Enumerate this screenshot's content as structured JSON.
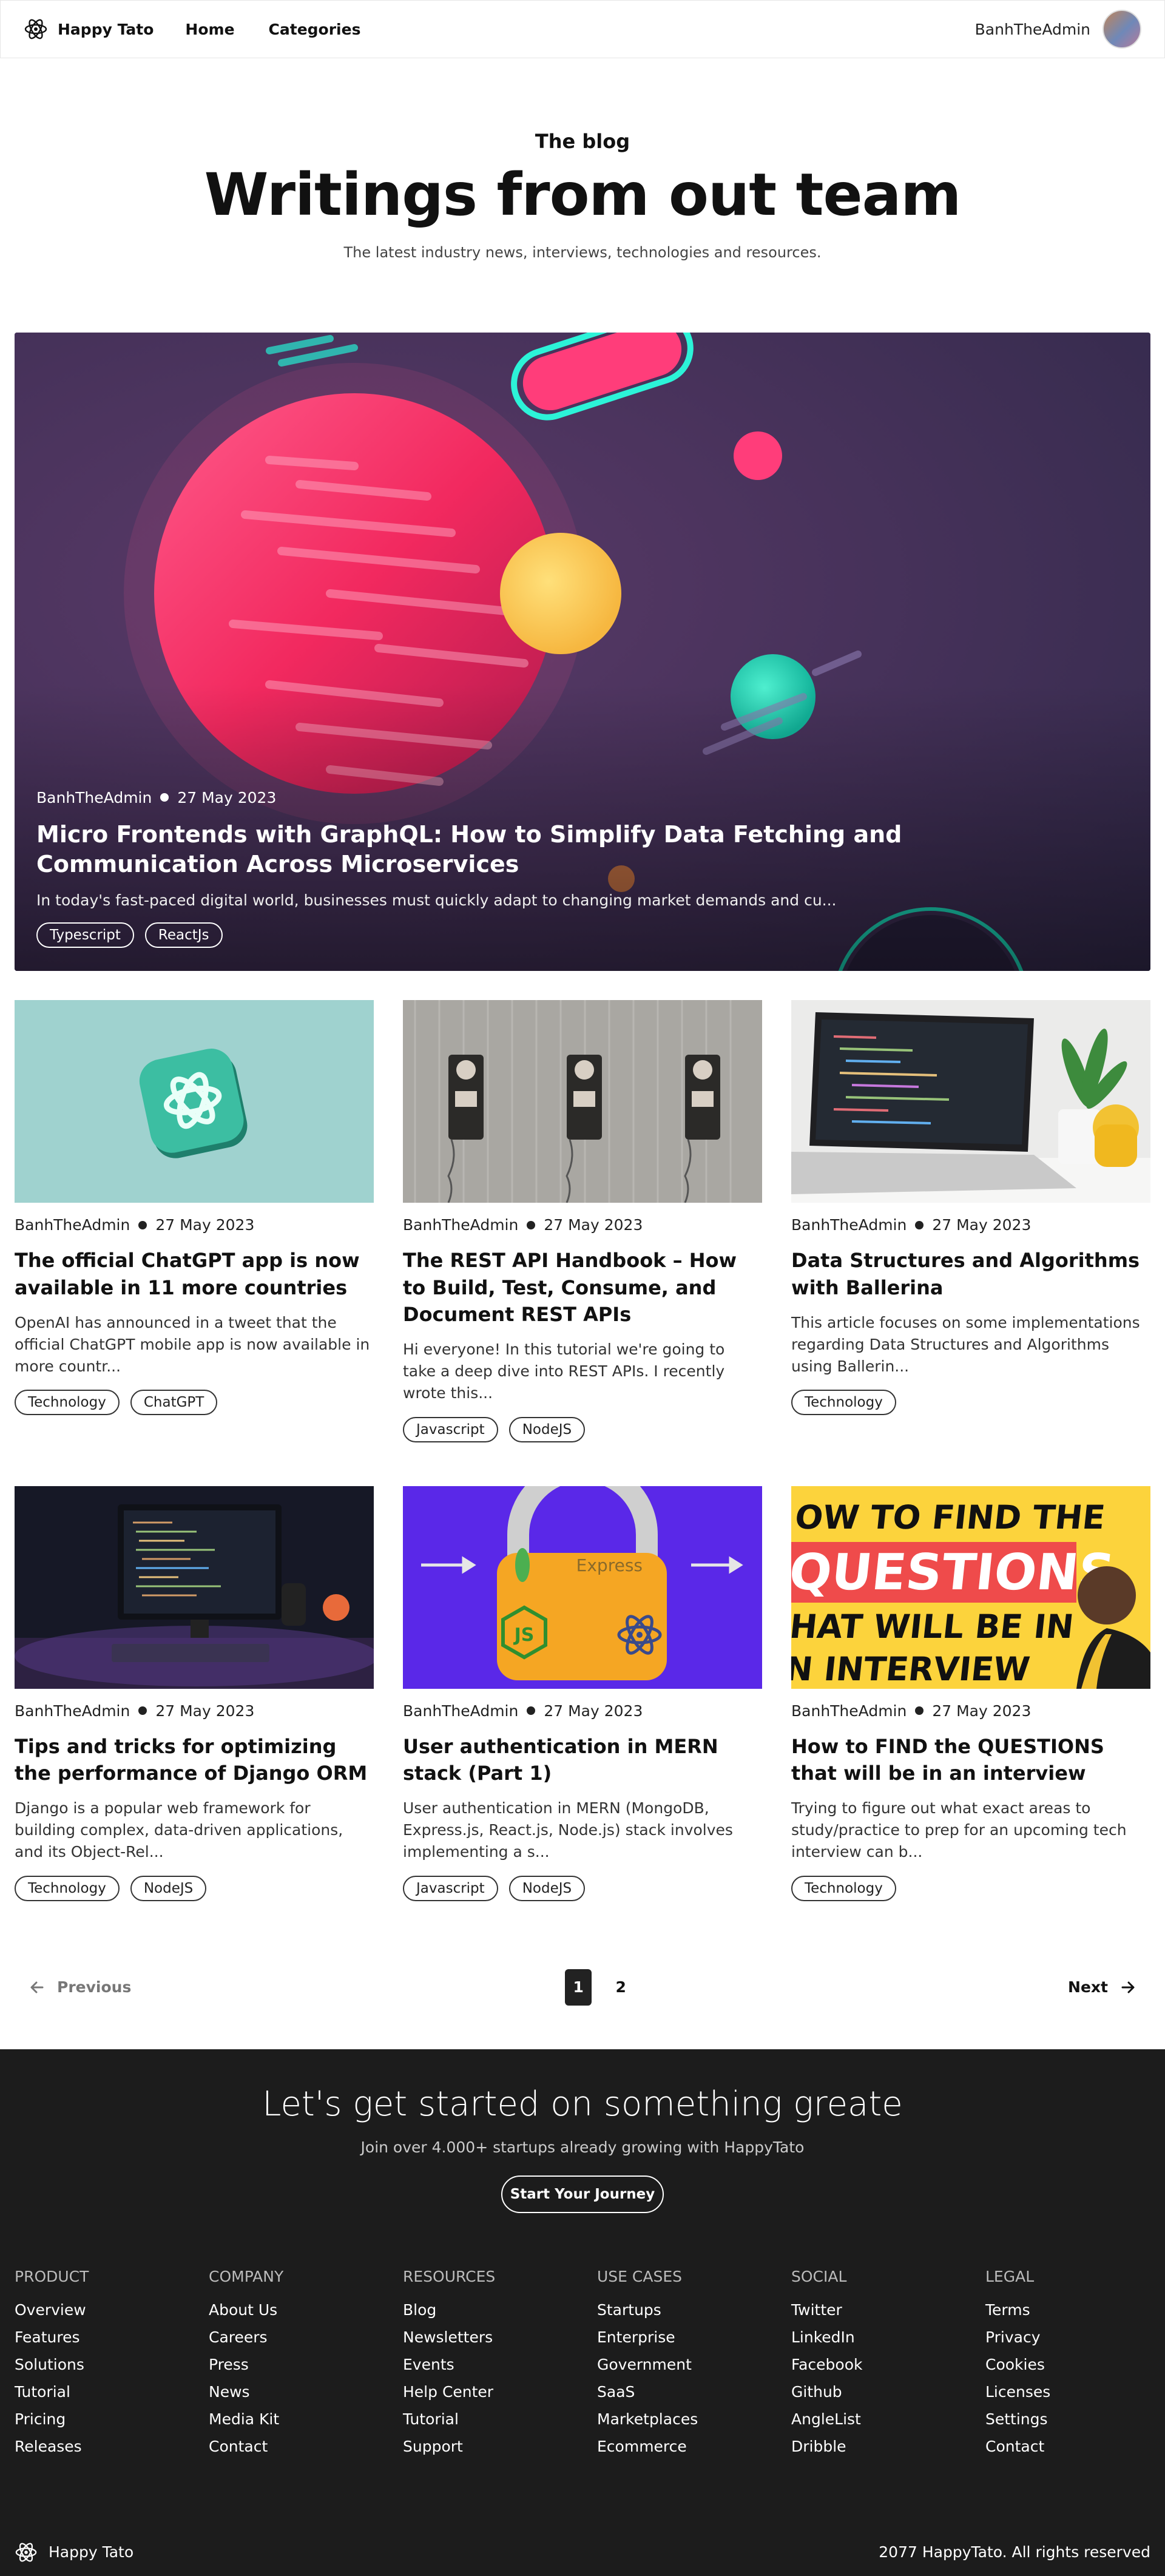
{
  "header": {
    "brand": "Happy Tato",
    "nav": [
      "Home",
      "Categories"
    ],
    "user": "BanhTheAdmin"
  },
  "hero": {
    "eyebrow": "The blog",
    "title": "Writings from out team",
    "subtitle": "The latest industry news, interviews, technologies and resources."
  },
  "featured": {
    "author": "BanhTheAdmin",
    "date": "27 May 2023",
    "title": "Micro Frontends with GraphQL: How to Simplify Data Fetching and Communication Across Microservices",
    "excerpt": "In today's fast-paced digital world, businesses must quickly adapt to changing market demands and cu...",
    "tags": [
      "Typescript",
      "ReactJs"
    ]
  },
  "posts": [
    {
      "author": "BanhTheAdmin",
      "date": "27 May 2023",
      "title": "The official ChatGPT app is now available in 11 more countries",
      "excerpt": "OpenAI has announced in a tweet that the official ChatGPT mobile app is now available in more countr...",
      "tags": [
        "Technology",
        "ChatGPT"
      ]
    },
    {
      "author": "BanhTheAdmin",
      "date": "27 May 2023",
      "title": "The REST API Handbook – How to Build, Test, Consume, and Document REST APIs",
      "excerpt": "Hi everyone! In this tutorial we're going to take a deep dive into REST APIs. I recently wrote this...",
      "tags": [
        "Javascript",
        "NodeJS"
      ]
    },
    {
      "author": "BanhTheAdmin",
      "date": "27 May 2023",
      "title": "Data Structures and Algorithms with Ballerina",
      "excerpt": "This article focuses on some implementations regarding Data Structures and Algorithms using Ballerin...",
      "tags": [
        "Technology"
      ]
    },
    {
      "author": "BanhTheAdmin",
      "date": "27 May 2023",
      "title": "Tips and tricks for optimizing the performance of Django ORM",
      "excerpt": "Django is a popular web framework for building complex, data-driven applications, and its Object-Rel...",
      "tags": [
        "Technology",
        "NodeJS"
      ]
    },
    {
      "author": "BanhTheAdmin",
      "date": "27 May 2023",
      "title": "User authentication in MERN stack (Part 1)",
      "excerpt": "User authentication in MERN (MongoDB, Express.js, React.js, Node.js) stack involves implementing a s...",
      "tags": [
        "Javascript",
        "NodeJS"
      ]
    },
    {
      "author": "BanhTheAdmin",
      "date": "27 May 2023",
      "title": "How to FIND the QUESTIONS that will be in an interview",
      "excerpt": "Trying to figure out what exact areas to study/practice to prep for an upcoming tech interview can b...",
      "tags": [
        "Technology"
      ]
    }
  ],
  "thumb_text": {
    "express": "Express",
    "js": "JS",
    "interview_lines": [
      "OW TO FIND THE",
      "QUESTIONS",
      "HAT WILL BE IN",
      "N INTERVIEW"
    ]
  },
  "pagination": {
    "prev": "Previous",
    "next": "Next",
    "pages": [
      "1",
      "2"
    ],
    "current": "1"
  },
  "footer": {
    "cta_title": "Let's get started on something greate",
    "cta_sub": "Join over 4.000+ startups already growing with HappyTato",
    "cta_button": "Start Your Journey",
    "columns": [
      {
        "title": "PRODUCT",
        "links": [
          "Overview",
          "Features",
          "Solutions",
          "Tutorial",
          "Pricing",
          "Releases"
        ]
      },
      {
        "title": "COMPANY",
        "links": [
          "About Us",
          "Careers",
          "Press",
          "News",
          "Media Kit",
          "Contact"
        ]
      },
      {
        "title": "RESOURCES",
        "links": [
          "Blog",
          "Newsletters",
          "Events",
          "Help Center",
          "Tutorial",
          "Support"
        ]
      },
      {
        "title": "USE CASES",
        "links": [
          "Startups",
          "Enterprise",
          "Government",
          "SaaS",
          "Marketplaces",
          "Ecommerce"
        ]
      },
      {
        "title": "SOCIAL",
        "links": [
          "Twitter",
          "LinkedIn",
          "Facebook",
          "Github",
          "AngleList",
          "Dribble"
        ]
      },
      {
        "title": "LEGAL",
        "links": [
          "Terms",
          "Privacy",
          "Cookies",
          "Licenses",
          "Settings",
          "Contact"
        ]
      }
    ],
    "brand": "Happy Tato",
    "copyright": "2077 HappyTato. All rights reserved"
  },
  "colors": {
    "featured_bg": "#433660",
    "footer_bg": "#1c1c1c",
    "active_page": "#222222"
  }
}
